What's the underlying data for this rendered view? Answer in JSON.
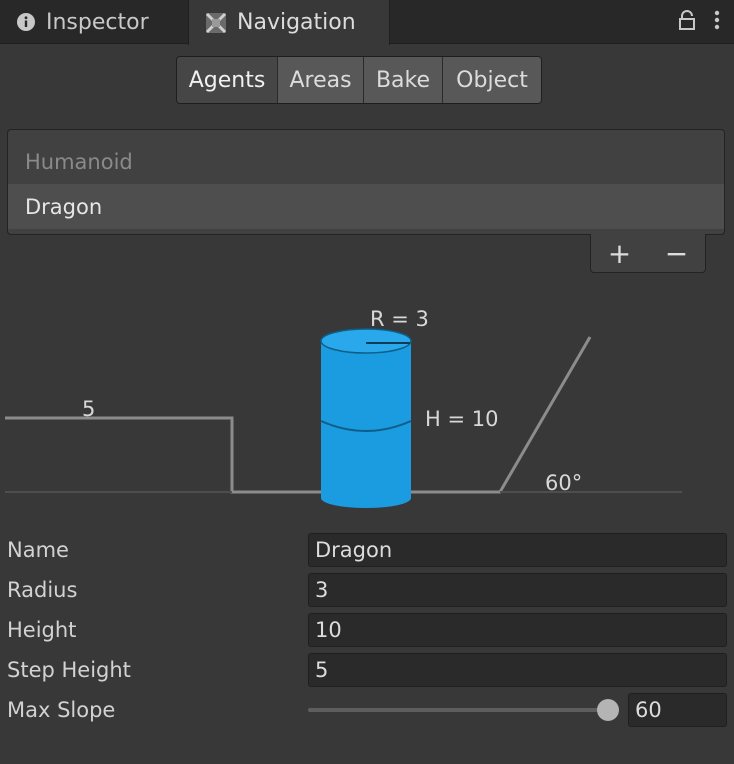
{
  "tabs": [
    {
      "label": "Inspector",
      "icon": "info-icon"
    },
    {
      "label": "Navigation",
      "icon": "navigation-icon"
    }
  ],
  "toolbar": {
    "buttons": [
      "Agents",
      "Areas",
      "Bake",
      "Object"
    ],
    "active": "Agents"
  },
  "agents": {
    "items": [
      "Humanoid",
      "Dragon"
    ],
    "selected": "Dragon",
    "add_label": "+",
    "remove_label": "−"
  },
  "diagram": {
    "radius_label": "R = 3",
    "height_label": "H = 10",
    "step_label": "5",
    "slope_label": "60°",
    "agent_color": "#1b9be0"
  },
  "properties": {
    "name": {
      "label": "Name",
      "value": "Dragon"
    },
    "radius": {
      "label": "Radius",
      "value": "3"
    },
    "height": {
      "label": "Height",
      "value": "10"
    },
    "step_height": {
      "label": "Step Height",
      "value": "5"
    },
    "max_slope": {
      "label": "Max Slope",
      "value": "60",
      "fraction": 1.0
    }
  }
}
